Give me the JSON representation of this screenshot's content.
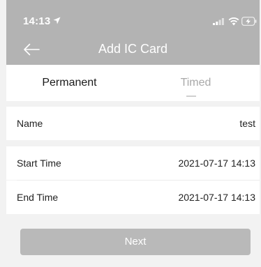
{
  "status_bar": {
    "time": "14:13"
  },
  "header": {
    "title": "Add IC Card"
  },
  "tabs": [
    {
      "label": "Permanent"
    },
    {
      "label": "Timed"
    }
  ],
  "form": {
    "name": {
      "label": "Name",
      "value": "test"
    },
    "start_time": {
      "label": "Start Time",
      "value": "2021-07-17 14:13"
    },
    "end_time": {
      "label": "End Time",
      "value": "2021-07-17 14:13"
    }
  },
  "actions": {
    "next_label": "Next"
  },
  "icons": {
    "location": "location-arrow-icon",
    "signal": "cellular-signal-icon",
    "wifi": "wifi-icon",
    "battery": "battery-charging-icon",
    "back": "back-arrow-icon"
  },
  "colors": {
    "header_bg": "#b3b3b3",
    "page_bg": "#f2f2f2",
    "active_tab": "#1a1a1a",
    "inactive_tab": "#a9a9a9",
    "button_bg": "#b9b9b9"
  }
}
